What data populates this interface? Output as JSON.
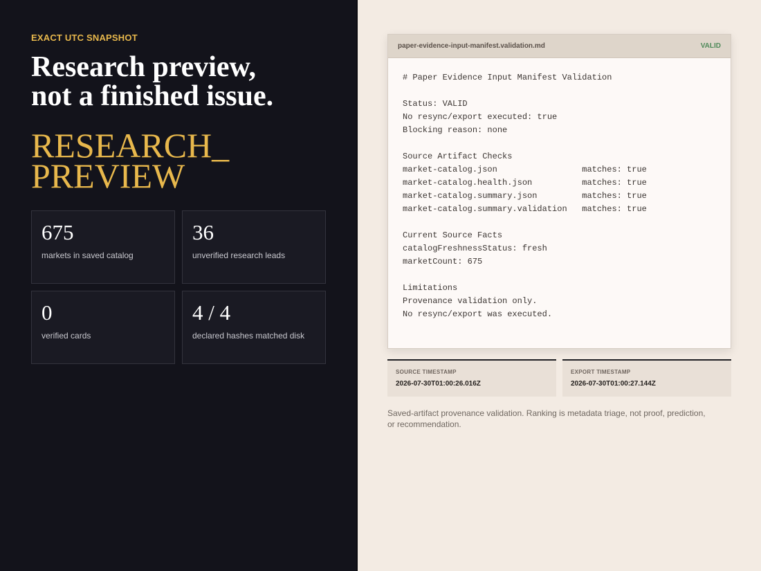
{
  "hero": {
    "eyebrow": "EXACT UTC SNAPSHOT",
    "headline_line1": "Research preview,",
    "headline_line2": "not a finished issue.",
    "tag_line1": "RESEARCH_",
    "tag_line2": "PREVIEW"
  },
  "stats": [
    {
      "value": "675",
      "label": "markets in saved catalog"
    },
    {
      "value": "36",
      "label": "unverified research leads"
    },
    {
      "value": "0",
      "label": "verified cards"
    },
    {
      "value": "4 / 4",
      "label": "declared hashes matched disk"
    }
  ],
  "document": {
    "filename": "paper-evidence-input-manifest.validation.md",
    "status": "VALID",
    "lines": [
      "# Paper Evidence Input Manifest Validation",
      "",
      "Status: VALID",
      "No resync/export executed: true",
      "Blocking reason: none",
      "",
      "Source Artifact Checks",
      "market-catalog.json                 matches: true",
      "market-catalog.health.json          matches: true",
      "market-catalog.summary.json         matches: true",
      "market-catalog.summary.validation   matches: true",
      "",
      "Current Source Facts",
      "catalogFreshnessStatus: fresh",
      "marketCount: 675",
      "",
      "Limitations",
      "Provenance validation only.",
      "No resync/export was executed."
    ]
  },
  "timestamps": {
    "source_label": "SOURCE TIMESTAMP",
    "source_value": "2026-07-30T01:00:26.016Z",
    "export_label": "EXPORT TIMESTAMP",
    "export_value": "2026-07-30T01:00:27.144Z"
  },
  "footnote": "Saved-artifact provenance validation. Ranking is metadata triage, not proof, prediction, or recommendation."
}
